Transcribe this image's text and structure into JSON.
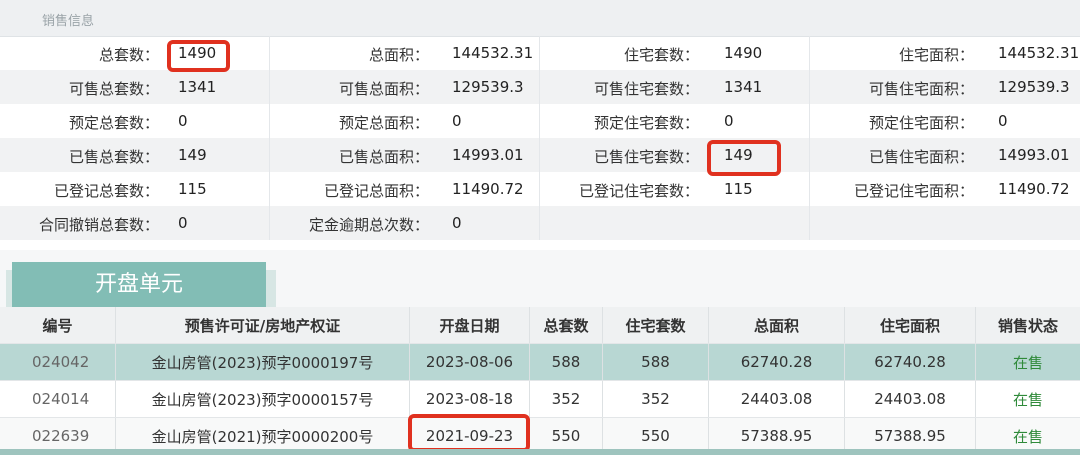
{
  "section_title": "销售信息",
  "stats": [
    [
      {
        "label": "总套数：",
        "value": "1490"
      },
      {
        "label": "总面积：",
        "value": "144532.31"
      },
      {
        "label": "住宅套数：",
        "value": "1490"
      },
      {
        "label": "住宅面积：",
        "value": "144532.31"
      }
    ],
    [
      {
        "label": "可售总套数：",
        "value": "1341"
      },
      {
        "label": "可售总面积：",
        "value": "129539.3"
      },
      {
        "label": "可售住宅套数：",
        "value": "1341"
      },
      {
        "label": "可售住宅面积：",
        "value": "129539.3"
      }
    ],
    [
      {
        "label": "预定总套数：",
        "value": "0"
      },
      {
        "label": "预定总面积：",
        "value": "0"
      },
      {
        "label": "预定住宅套数：",
        "value": "0"
      },
      {
        "label": "预定住宅面积：",
        "value": "0"
      }
    ],
    [
      {
        "label": "已售总套数：",
        "value": "149"
      },
      {
        "label": "已售总面积：",
        "value": "14993.01"
      },
      {
        "label": "已售住宅套数：",
        "value": "149"
      },
      {
        "label": "已售住宅面积：",
        "value": "14993.01"
      }
    ],
    [
      {
        "label": "已登记总套数：",
        "value": "115"
      },
      {
        "label": "已登记总面积：",
        "value": "11490.72"
      },
      {
        "label": "已登记住宅套数：",
        "value": "115"
      },
      {
        "label": "已登记住宅面积：",
        "value": "11490.72"
      }
    ],
    [
      {
        "label": "合同撤销总套数：",
        "value": "0"
      },
      {
        "label": "定金逾期总次数：",
        "value": "0"
      },
      {
        "label": "",
        "value": ""
      },
      {
        "label": "",
        "value": ""
      }
    ]
  ],
  "tab_label": "开盘单元",
  "table": {
    "headers": [
      "编号",
      "预售许可证/房地产权证",
      "开盘日期",
      "总套数",
      "住宅套数",
      "总面积",
      "住宅面积",
      "销售状态"
    ],
    "rows": [
      [
        "024042",
        "金山房管(2023)预字0000197号",
        "2023-08-06",
        "588",
        "588",
        "62740.28",
        "62740.28",
        "在售"
      ],
      [
        "024014",
        "金山房管(2023)预字0000157号",
        "2023-08-18",
        "352",
        "352",
        "24403.08",
        "24403.08",
        "在售"
      ],
      [
        "022639",
        "金山房管(2021)预字0000200号",
        "2021-09-23",
        "550",
        "550",
        "57388.95",
        "57388.95",
        "在售"
      ]
    ]
  },
  "colors": {
    "highlight": "#e0311f",
    "tab": "#82bdb5",
    "selected_row": "#b8d7d3",
    "status": "#2f8a3a"
  }
}
